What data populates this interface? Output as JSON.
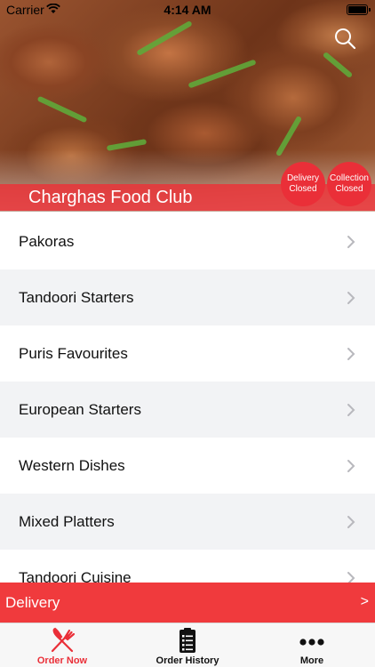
{
  "status_bar": {
    "carrier": "Carrier",
    "time": "4:14 AM",
    "wifi_icon": "wifi-icon",
    "battery_icon": "battery-icon"
  },
  "header": {
    "restaurant_name": "Charghas Food Club",
    "search_icon": "search-icon",
    "delivery_badge": {
      "line1": "Delivery",
      "line2": "Closed"
    },
    "collection_badge": {
      "line1": "Collection",
      "line2": "Closed"
    }
  },
  "menu": {
    "categories": [
      {
        "label": "Pakoras"
      },
      {
        "label": "Tandoori Starters"
      },
      {
        "label": "Puris Favourites"
      },
      {
        "label": "European Starters"
      },
      {
        "label": "Western Dishes"
      },
      {
        "label": "Mixed Platters"
      },
      {
        "label": "Tandoori Cuisine"
      }
    ]
  },
  "delivery_bar": {
    "label": "Delivery",
    "arrow": ">"
  },
  "tab_bar": {
    "tabs": [
      {
        "label": "Order Now",
        "icon": "fork-knife-icon",
        "active": true
      },
      {
        "label": "Order History",
        "icon": "clipboard-icon",
        "active": false
      },
      {
        "label": "More",
        "icon": "more-dots-icon",
        "active": false
      }
    ]
  },
  "colors": {
    "accent": "#ea2f38",
    "delivery_bar": "#f03a3d",
    "alt_row": "#f2f3f5"
  }
}
